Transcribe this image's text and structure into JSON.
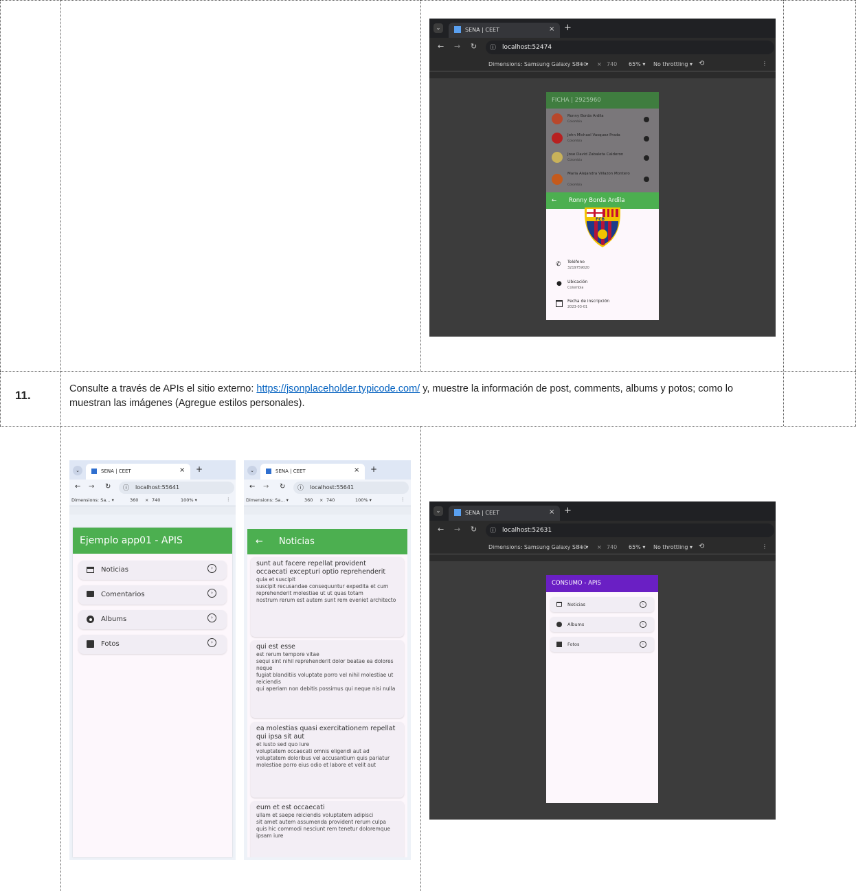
{
  "row11": {
    "number": "11.",
    "text_before": "Consulte a través de APIs el sitio externo: ",
    "link": "https://jsonplaceholder.typicode.com/",
    "text_after": " y, muestre la información de post, comments, albums y potos; como lo muestran las imágenes (Agregue estilos personales)."
  },
  "shot_ficha": {
    "tab_title": "SENA | CEET",
    "url": "localhost:52474",
    "devtools": {
      "dimensions": "Dimensions: Samsung Galaxy S8+ ▾",
      "width": "360",
      "x": "×",
      "height": "740",
      "zoom": "65% ▾",
      "throttle": "No throttling ▾"
    },
    "appbar": "FICHA | 2925960",
    "people": [
      {
        "name": "Ronny Borda Ardila",
        "country": "Colombia"
      },
      {
        "name": "John Michael Vasquez Prada",
        "country": "Colombia"
      },
      {
        "name": "Jose David Zabaleta Calderon",
        "country": "Colombia"
      },
      {
        "name": "Maria Alejandra Villazon Montero",
        "country": "Colombia"
      }
    ],
    "detail_bar": "Ronny Borda Ardila",
    "crest_text": "FCB",
    "fields": [
      {
        "label": "Teléfono",
        "value": "3219759020"
      },
      {
        "label": "Ubicación",
        "value": "Colombia"
      },
      {
        "label": "Fecha de inscripción",
        "value": "2023-03-01"
      }
    ]
  },
  "shot_menu": {
    "tab_title": "SENA | CEET",
    "url": "localhost:55641",
    "devtools": {
      "dimensions": "Dimensions: Sa... ▾",
      "width": "360",
      "x": "×",
      "height": "740",
      "zoom": "100% ▾"
    },
    "appbar": "Ejemplo app01 - APIS",
    "items": [
      "Noticias",
      "Comentarios",
      "Albums",
      "Fotos"
    ]
  },
  "shot_noticias": {
    "tab_title": "SENA | CEET",
    "url": "localhost:55641",
    "devtools": {
      "dimensions": "Dimensions: Sa... ▾",
      "width": "360",
      "x": "×",
      "height": "740",
      "zoom": "100% ▾"
    },
    "appbar": "Noticias",
    "posts": [
      {
        "title": "sunt aut facere repellat provident occaecati excepturi optio reprehenderit",
        "body": [
          "quia et suscipit",
          "suscipit recusandae consequuntur expedita et cum",
          "reprehenderit molestiae ut ut quas totam",
          "nostrum rerum est autem sunt rem eveniet architecto"
        ]
      },
      {
        "title": "qui est esse",
        "body": [
          "est rerum tempore vitae",
          "sequi sint nihil reprehenderit dolor beatae ea dolores neque",
          "fugiat blanditiis voluptate porro vel nihil molestiae ut reiciendis",
          "qui aperiam non debitis possimus qui neque nisi nulla"
        ]
      },
      {
        "title": "ea molestias quasi exercitationem repellat qui ipsa sit aut",
        "body": [
          "et iusto sed quo iure",
          "voluptatem occaecati omnis eligendi aut ad",
          "voluptatem doloribus vel accusantium quis pariatur",
          "molestiae porro eius odio et labore et velit aut"
        ]
      },
      {
        "title": "eum et est occaecati",
        "body": [
          "ullam et saepe reiciendis voluptatem adipisci",
          "sit amet autem assumenda provident rerum culpa",
          "quis hic commodi nesciunt rem tenetur doloremque ipsam iure"
        ]
      }
    ]
  },
  "shot_consumo": {
    "tab_title": "SENA | CEET",
    "url": "localhost:52631",
    "devtools": {
      "dimensions": "Dimensions: Samsung Galaxy S8+ ▾",
      "width": "360",
      "x": "×",
      "height": "740",
      "zoom": "65% ▾",
      "throttle": "No throttling ▾"
    },
    "appbar": "CONSUMO - APIS",
    "items": [
      "Noticias",
      "Albums",
      "Fotos"
    ]
  },
  "colors": {
    "green": "#4caf50",
    "purple": "#6a1fc4",
    "dark_bg": "#3c3c3c",
    "fcb_blue": "#1b3b8a",
    "fcb_red": "#b3143a"
  }
}
